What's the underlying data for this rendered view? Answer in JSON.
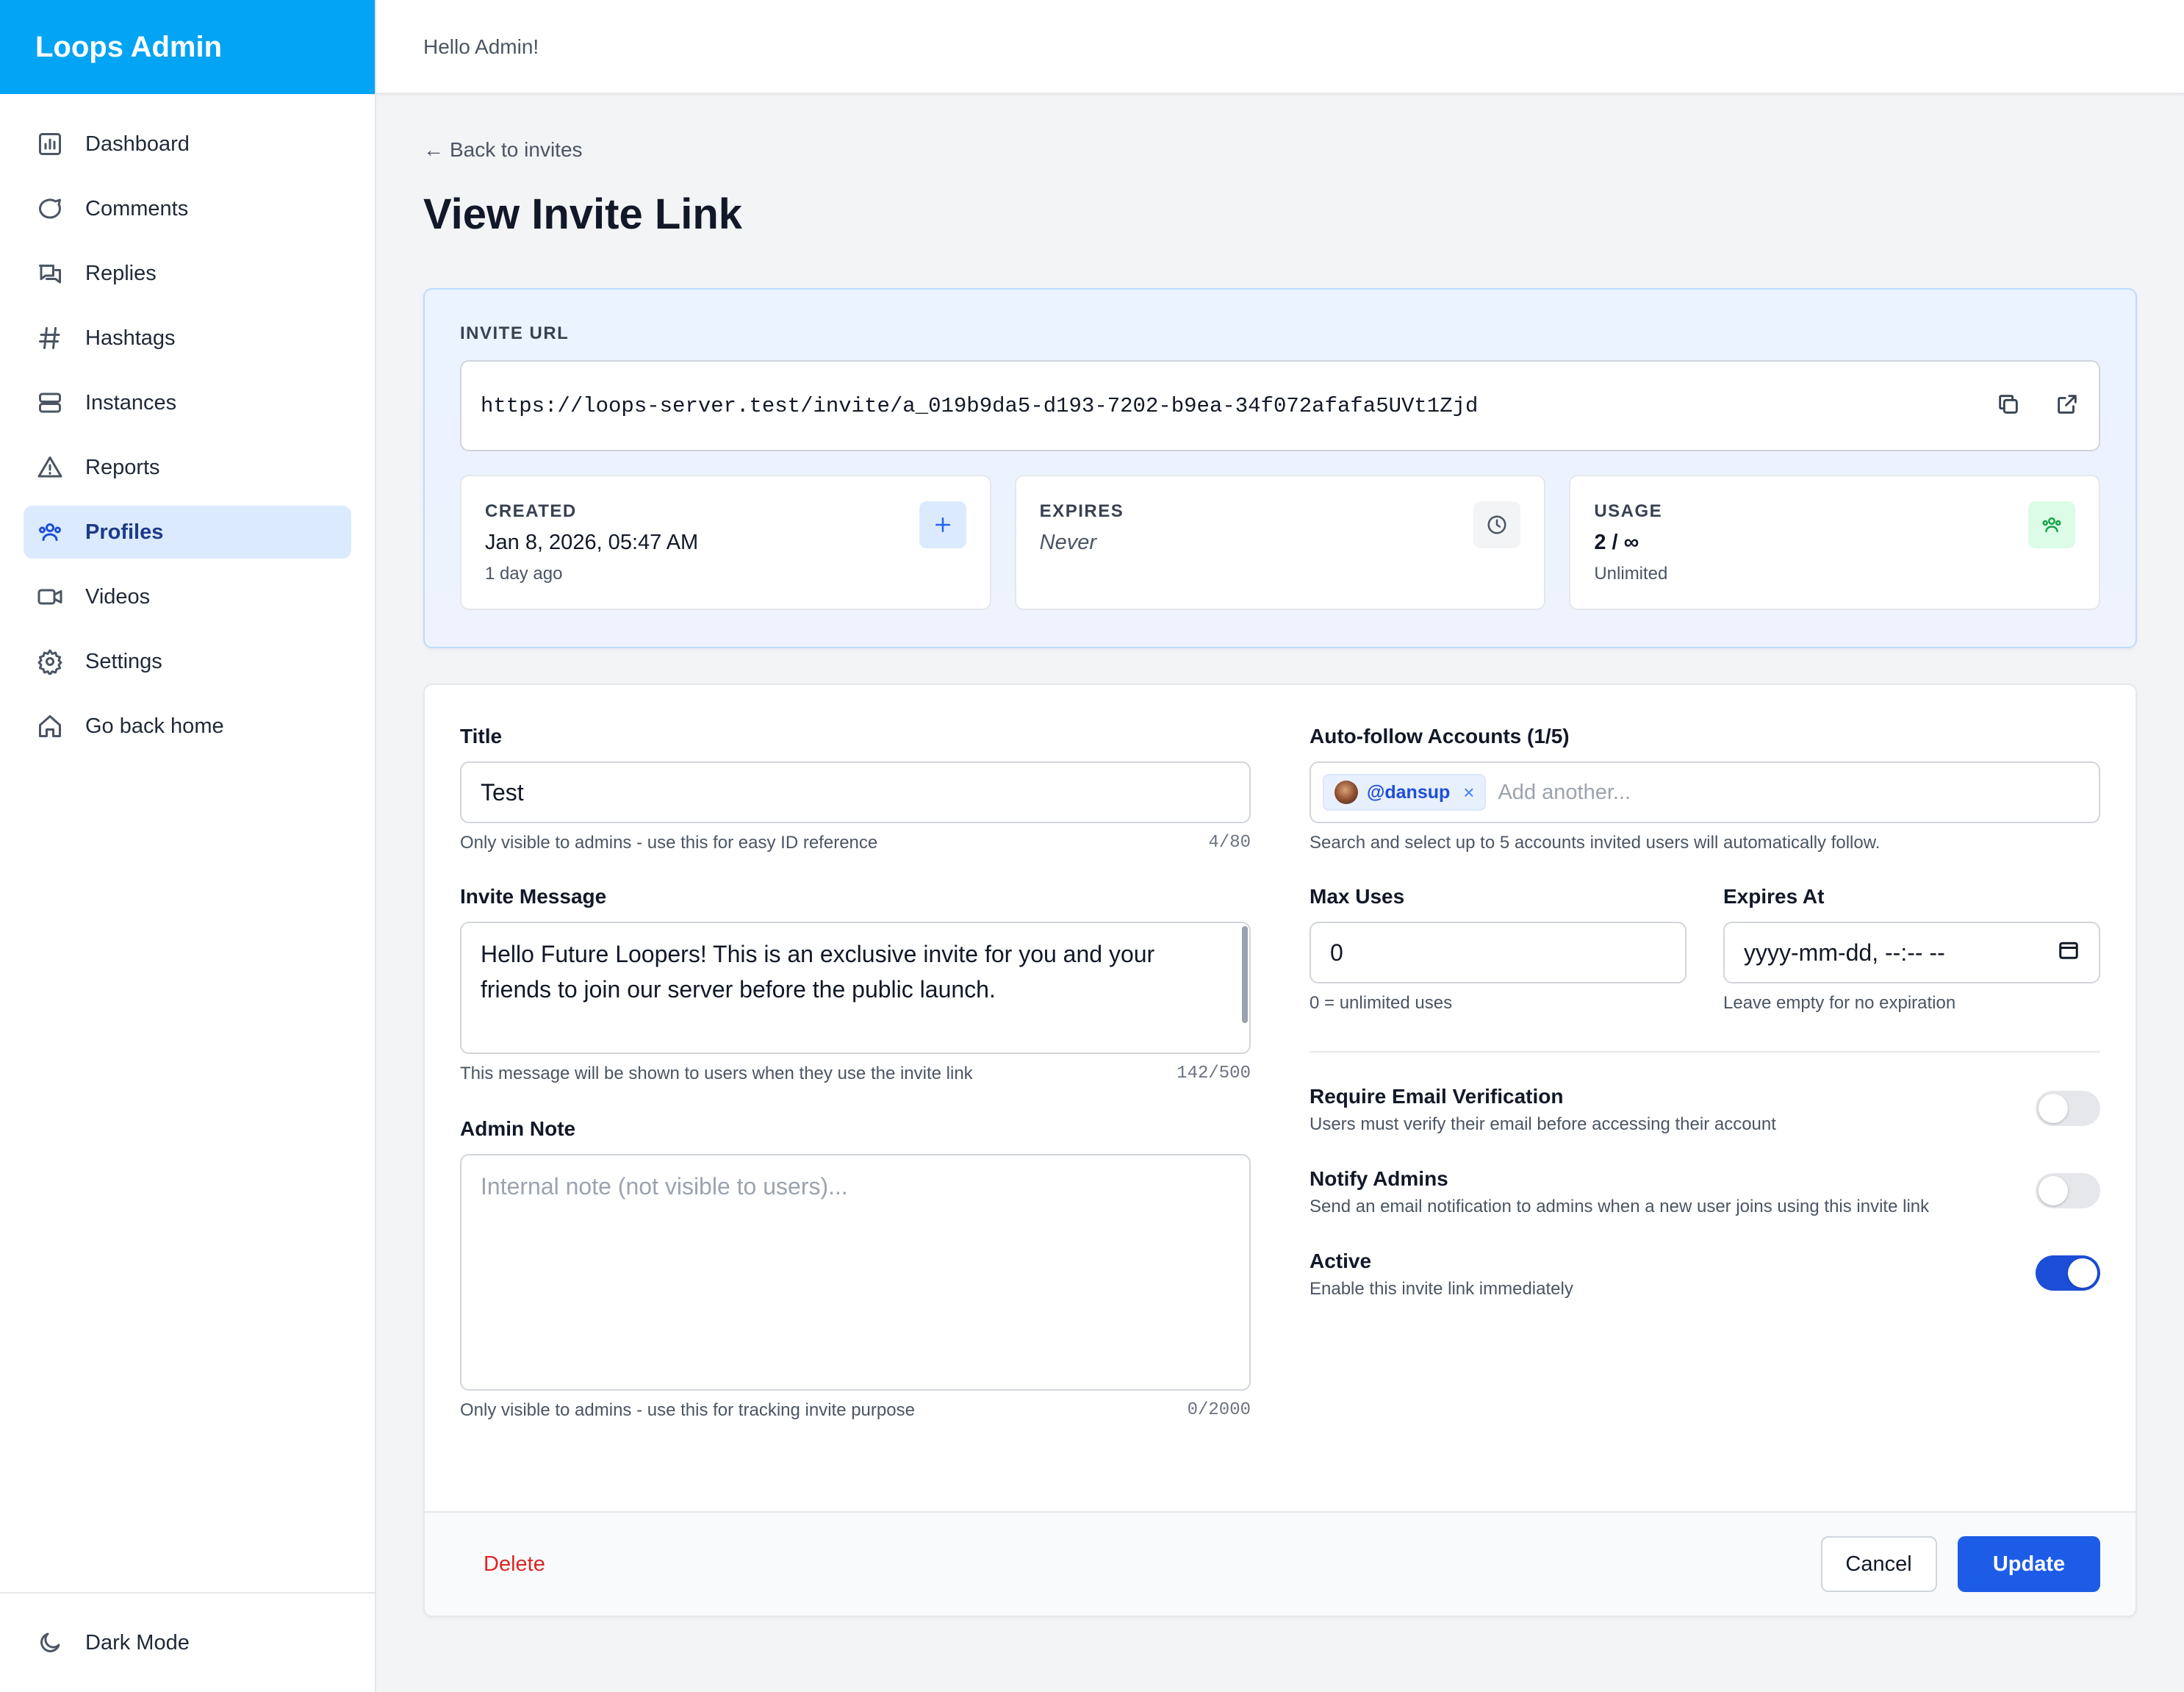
{
  "app": {
    "brand": "Loops Admin",
    "greeting": "Hello Admin!"
  },
  "sidebar": {
    "items": [
      {
        "label": "Dashboard",
        "icon": "chart-icon"
      },
      {
        "label": "Comments",
        "icon": "comment-icon"
      },
      {
        "label": "Replies",
        "icon": "replies-icon"
      },
      {
        "label": "Hashtags",
        "icon": "hashtag-icon"
      },
      {
        "label": "Instances",
        "icon": "server-icon"
      },
      {
        "label": "Reports",
        "icon": "warning-icon"
      },
      {
        "label": "Profiles",
        "icon": "users-icon",
        "active": true
      },
      {
        "label": "Videos",
        "icon": "video-icon"
      },
      {
        "label": "Settings",
        "icon": "gear-icon"
      },
      {
        "label": "Go back home",
        "icon": "home-icon"
      }
    ],
    "dark_mode_label": "Dark Mode"
  },
  "page": {
    "back_label": "Back to invites",
    "title": "View Invite Link"
  },
  "invite": {
    "url_label": "INVITE URL",
    "url": "https://loops-server.test/invite/a_019b9da5-d193-7202-b9ea-34f072afafa5UVt1Zjd",
    "created": {
      "label": "CREATED",
      "value": "Jan 8, 2026, 05:47 AM",
      "sub": "1 day ago"
    },
    "expires": {
      "label": "EXPIRES",
      "value": "Never"
    },
    "usage": {
      "label": "USAGE",
      "value": "2 / ∞",
      "sub": "Unlimited"
    }
  },
  "form": {
    "title": {
      "label": "Title",
      "value": "Test",
      "help": "Only visible to admins - use this for easy ID reference",
      "counter": "4/80"
    },
    "message": {
      "label": "Invite Message",
      "value": "Hello Future Loopers! This is an exclusive invite for you and your friends to join our server before the public launch.",
      "help": "This message will be shown to users when they use the invite link",
      "counter": "142/500"
    },
    "note": {
      "label": "Admin Note",
      "placeholder": "Internal note (not visible to users)...",
      "help": "Only visible to admins - use this for tracking invite purpose",
      "counter": "0/2000"
    },
    "autofollow": {
      "label": "Auto-follow Accounts (1/5)",
      "tag": "@dansup",
      "placeholder": "Add another...",
      "help": "Search and select up to 5 accounts invited users will automatically follow."
    },
    "max_uses": {
      "label": "Max Uses",
      "value": "0",
      "help": "0 = unlimited uses"
    },
    "expires_at": {
      "label": "Expires At",
      "placeholder": "yyyy-mm-dd, --:-- --",
      "help": "Leave empty for no expiration"
    },
    "toggles": [
      {
        "title": "Require Email Verification",
        "desc": "Users must verify their email before accessing their account",
        "on": false
      },
      {
        "title": "Notify Admins",
        "desc": "Send an email notification to admins when a new user joins using this invite link",
        "on": false
      },
      {
        "title": "Active",
        "desc": "Enable this invite link immediately",
        "on": true
      }
    ]
  },
  "actions": {
    "delete": "Delete",
    "cancel": "Cancel",
    "update": "Update"
  },
  "colors": {
    "brand": "#03a4f4",
    "primary": "#1d5ce6",
    "danger": "#dc2626"
  }
}
